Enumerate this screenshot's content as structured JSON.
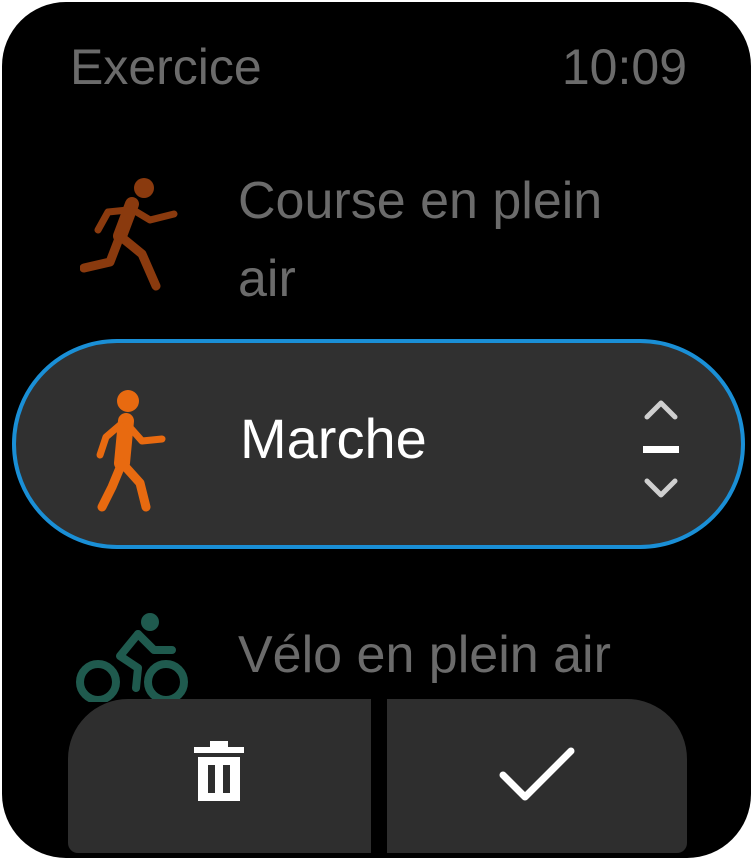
{
  "header": {
    "title": "Exercice",
    "time": "10:09"
  },
  "activities": [
    {
      "label_line1": "Course en plein",
      "label_line2": "air",
      "icon": "running-icon",
      "color": "#8a3a0e"
    },
    {
      "label": "Marche",
      "icon": "walking-icon",
      "color": "#e86a10",
      "selected": true
    },
    {
      "label": "Vélo en plein air",
      "icon": "cycling-icon",
      "color": "#1f5a4e"
    }
  ],
  "scroll_control": {
    "up_icon": "chevron-up-icon",
    "down_icon": "chevron-down-icon"
  },
  "actions": {
    "delete_icon": "trash-icon",
    "confirm_icon": "check-icon"
  },
  "colors": {
    "selection_border": "#1a8fd6",
    "dim_text": "#6b6b6b",
    "button_bg": "#2e2e2e"
  }
}
